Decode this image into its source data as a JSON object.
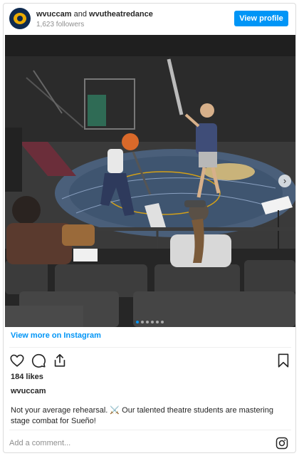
{
  "header": {
    "account_primary": "wvuccam",
    "conjunction": "and",
    "account_secondary": "wvutheatredance",
    "followers": "1,623 followers",
    "view_profile_label": "View profile",
    "avatar_icon": "wvu-logo-icon"
  },
  "carousel": {
    "slide_count": 6,
    "active_index": 0,
    "next_icon": "chevron-right-icon",
    "next_glyph": "›"
  },
  "post": {
    "view_more_label": "View more on Instagram",
    "likes": "184 likes",
    "username": "wvuccam",
    "caption": "Not your average rehearsal. ⚔️ Our talented theatre students are mastering stage combat for Sueño!",
    "comment_placeholder": "Add a comment...",
    "icons": [
      "heart-icon",
      "comment-icon",
      "share-icon",
      "bookmark-icon",
      "instagram-icon"
    ]
  },
  "colors": {
    "accent": "#0095f6",
    "text": "#262626",
    "muted": "#8e8e8e",
    "border": "#dbdbdb"
  }
}
